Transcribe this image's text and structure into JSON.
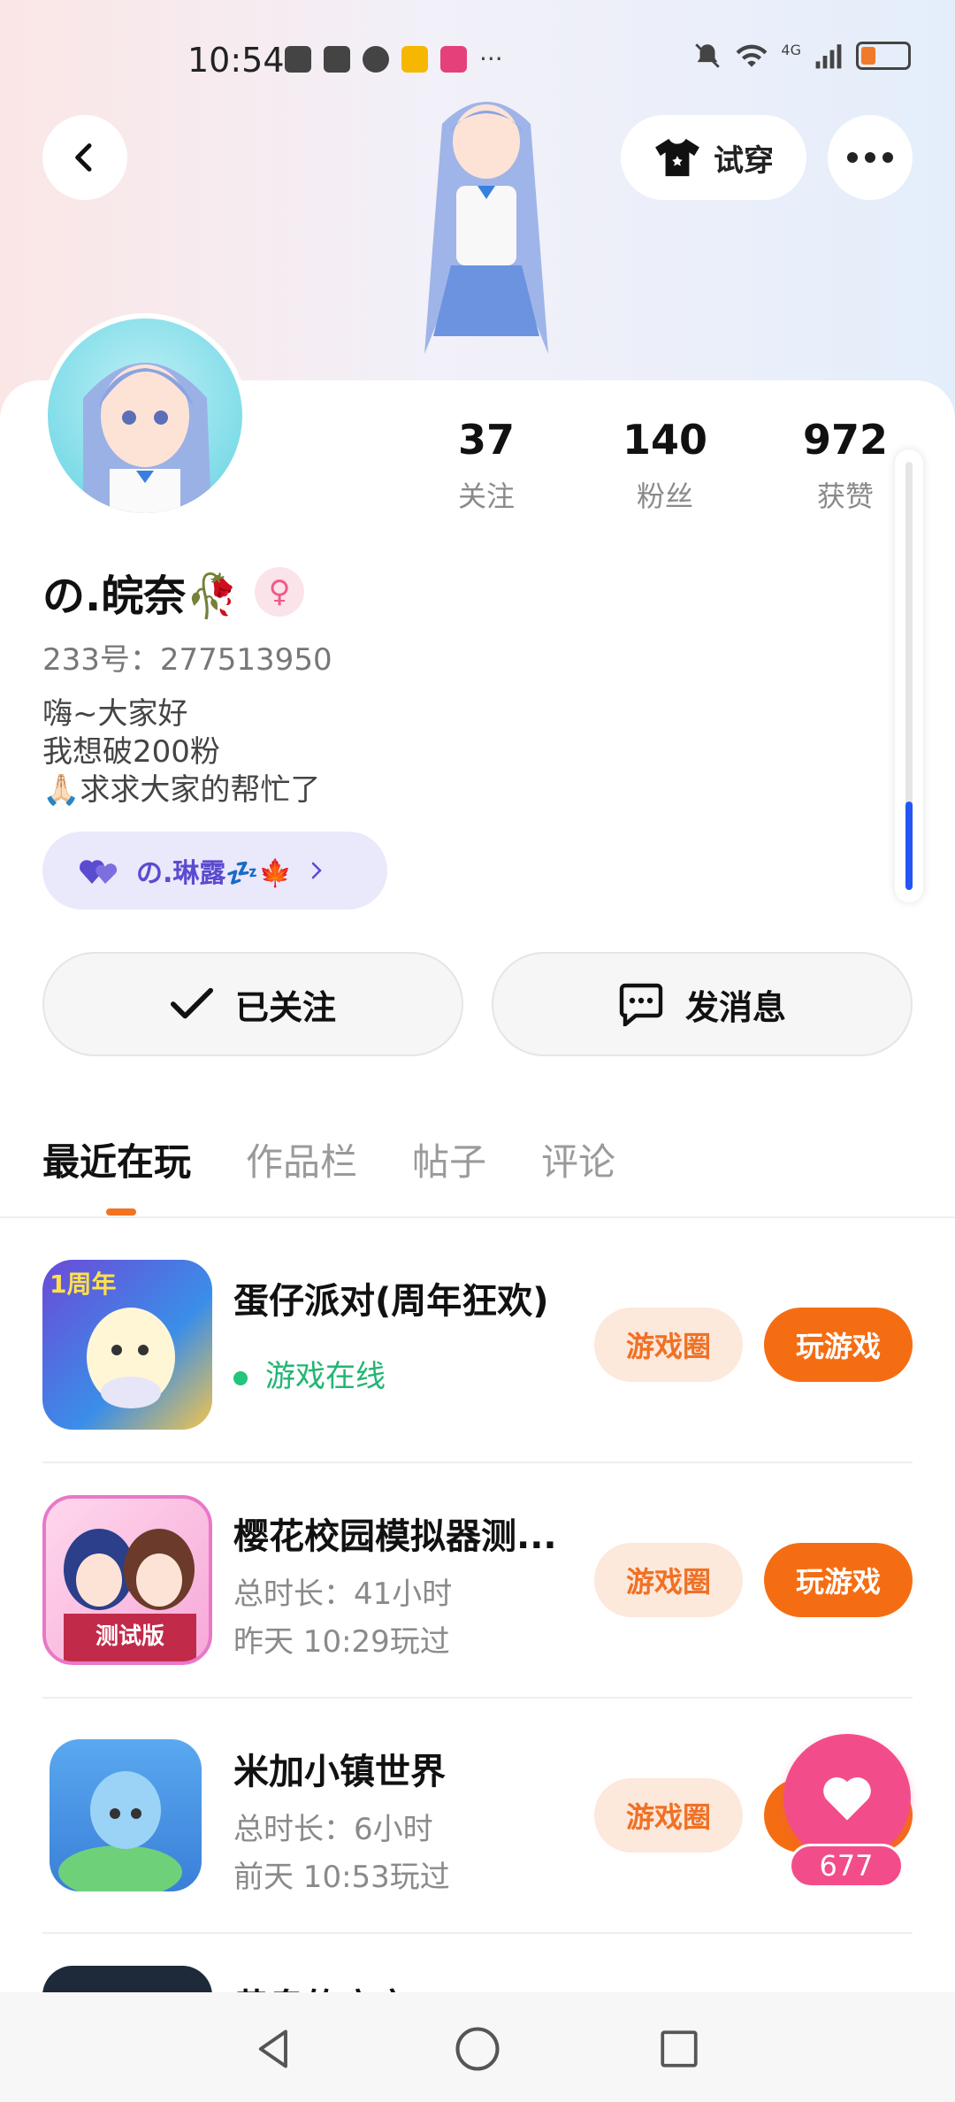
{
  "status_bar": {
    "time": "10:54",
    "ellipsis": "···",
    "network": "4G"
  },
  "header": {
    "try_on_label": "试穿"
  },
  "profile": {
    "name": "の.皖奈🥀",
    "gender_symbol": "♀",
    "uid": "233号：277513950",
    "bio_lines": [
      "嗨~大家好",
      "我想破200粉",
      "🙏🏻求求大家的帮忙了"
    ],
    "relation_label": "の.琳露💤🍁",
    "stats": [
      {
        "value": "37",
        "label": "关注"
      },
      {
        "value": "140",
        "label": "粉丝"
      },
      {
        "value": "972",
        "label": "获赞"
      }
    ]
  },
  "actions": {
    "follow_label": "已关注",
    "message_label": "发消息"
  },
  "tabs": [
    {
      "label": "最近在玩",
      "active": true
    },
    {
      "label": "作品栏",
      "active": false
    },
    {
      "label": "帖子",
      "active": false
    },
    {
      "label": "评论",
      "active": false
    }
  ],
  "games": [
    {
      "title": "蛋仔派对(周年狂欢)",
      "line1": "游戏在线",
      "line2": "",
      "circle_label": "游戏圈",
      "play_label": "玩游戏",
      "icon_badge": "1周年"
    },
    {
      "title": "樱花校园模拟器测...",
      "line1": "总时长：41小时",
      "line2": "昨天 10:29玩过",
      "circle_label": "游戏圈",
      "play_label": "玩游戏",
      "icon_badge": "测试版"
    },
    {
      "title": "米加小镇世界",
      "line1": "总时长：6小时",
      "line2": "前天 10:53玩过",
      "circle_label": "游戏圈",
      "play_label": "玩游戏",
      "icon_badge": ""
    },
    {
      "title": "黄泉的广宁",
      "line1": "",
      "line2": "",
      "circle_label": "",
      "play_label": "",
      "icon_badge": ""
    }
  ],
  "like": {
    "count": "677"
  },
  "colors": {
    "accent_orange": "#f56d12",
    "like_pink": "#f24d8a",
    "online_green": "#22b573",
    "scroll_blue": "#2556f5"
  }
}
